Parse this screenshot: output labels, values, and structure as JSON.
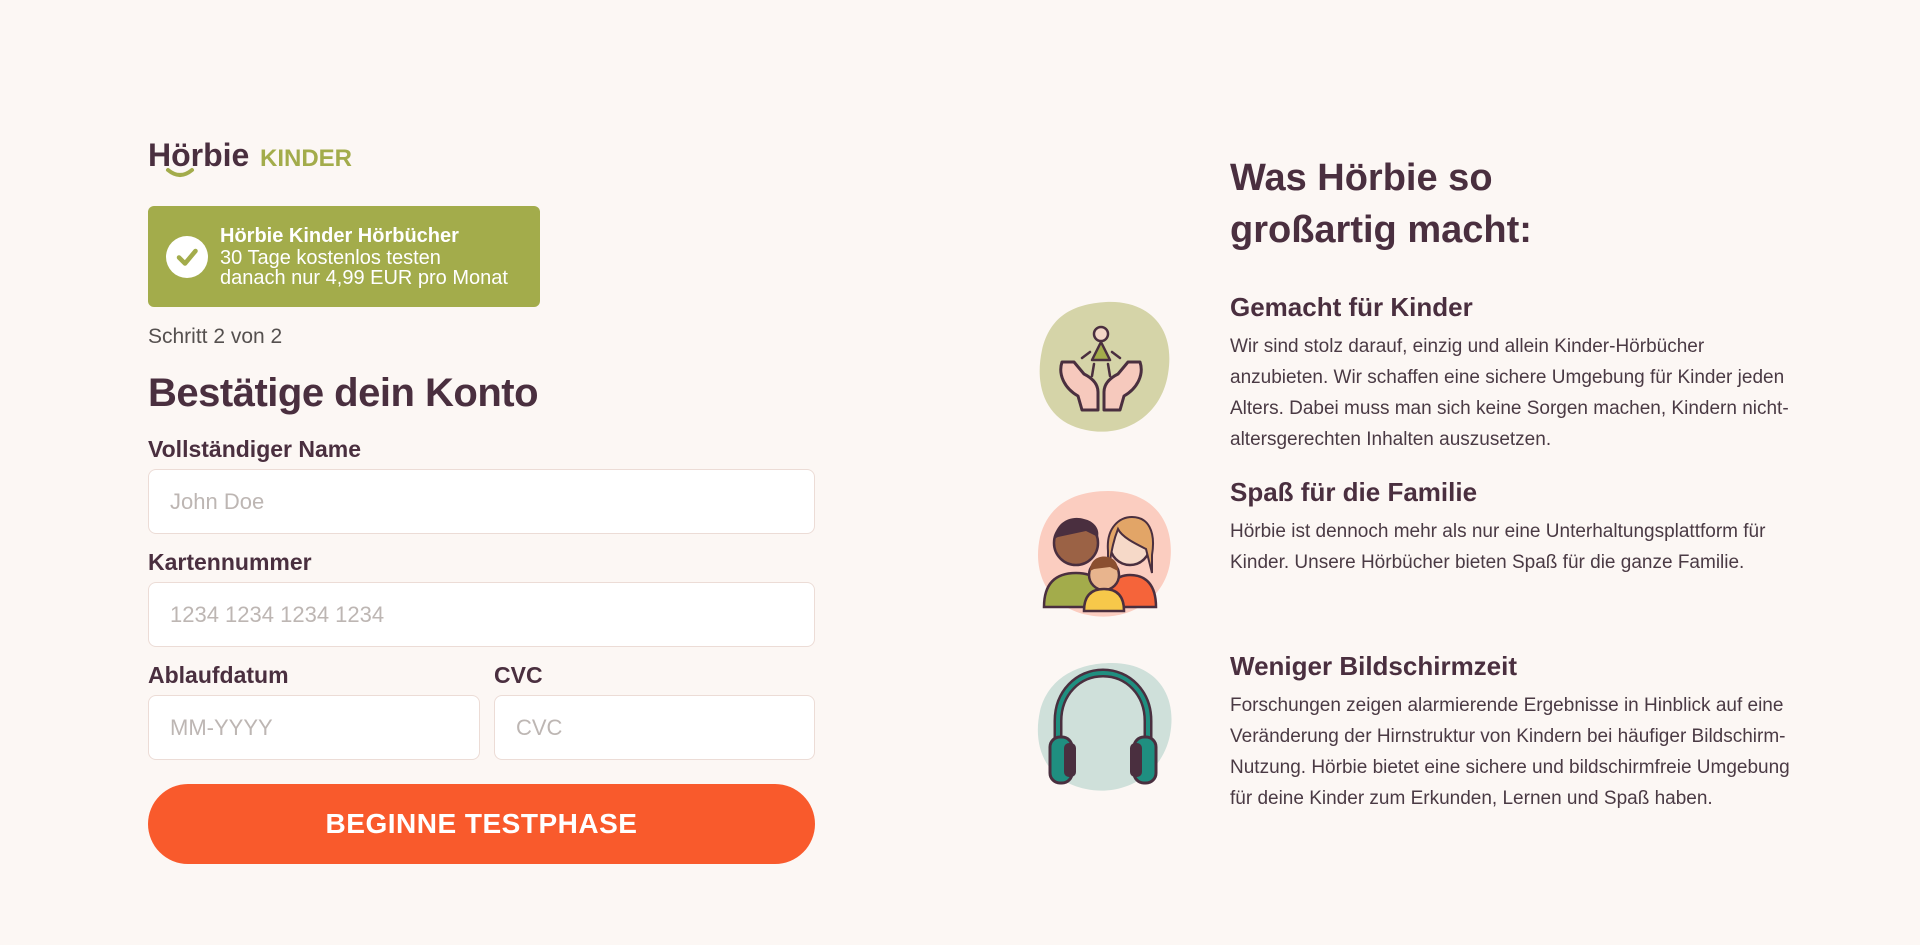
{
  "brand": {
    "logo_text": "Hörbie",
    "logo_suffix": "KINDER",
    "primary_color": "#4a2f3f",
    "accent_color": "#a3ac4b"
  },
  "promo": {
    "title": "Hörbie Kinder Hörbücher",
    "line1": "30 Tage kostenlos testen",
    "line2": "danach nur 4,99 EUR pro Monat",
    "icon": "check-icon"
  },
  "form": {
    "step": "Schritt 2 von 2",
    "heading": "Bestätige dein Konto",
    "name_label": "Vollständiger Name",
    "name_placeholder": "John Doe",
    "card_label": "Kartennummer",
    "card_placeholder": "1234 1234 1234 1234",
    "expiry_label": "Ablaufdatum",
    "expiry_placeholder": "MM-YYYY",
    "cvc_label": "CVC",
    "cvc_placeholder": "CVC",
    "submit_label": "BEGINNE TESTPHASE",
    "submit_color": "#f95a2c"
  },
  "benefits": {
    "title": "Was Hörbie so großartig macht:",
    "items": [
      {
        "title": "Gemacht für Kinder",
        "body": "Wir sind stolz darauf, einzig und allein Kinder-Hörbücher anzubieten. Wir schaffen eine sichere Umgebung für Kinder jeden Alters. Dabei muss man sich keine Sorgen machen, Kindern nicht-altersgerechten Inhalten auszusetzen.",
        "icon": "child-in-hands-icon"
      },
      {
        "title": "Spaß für die Familie",
        "body": "Hörbie ist dennoch mehr als nur eine Unterhaltungsplattform für Kinder. Unsere Hörbücher bieten Spaß für die ganze Familie.",
        "icon": "family-icon"
      },
      {
        "title": "Weniger Bildschirmzeit",
        "body": "Forschungen zeigen alarmierende Ergebnisse in Hinblick auf eine Veränderung der Hirnstruktur von Kindern bei häufiger Bildschirm-Nutzung. Hörbie bietet eine sichere und bildschirmfreie Umgebung für deine Kinder zum Erkunden, Lernen und Spaß haben.",
        "icon": "headphones-icon"
      }
    ]
  }
}
